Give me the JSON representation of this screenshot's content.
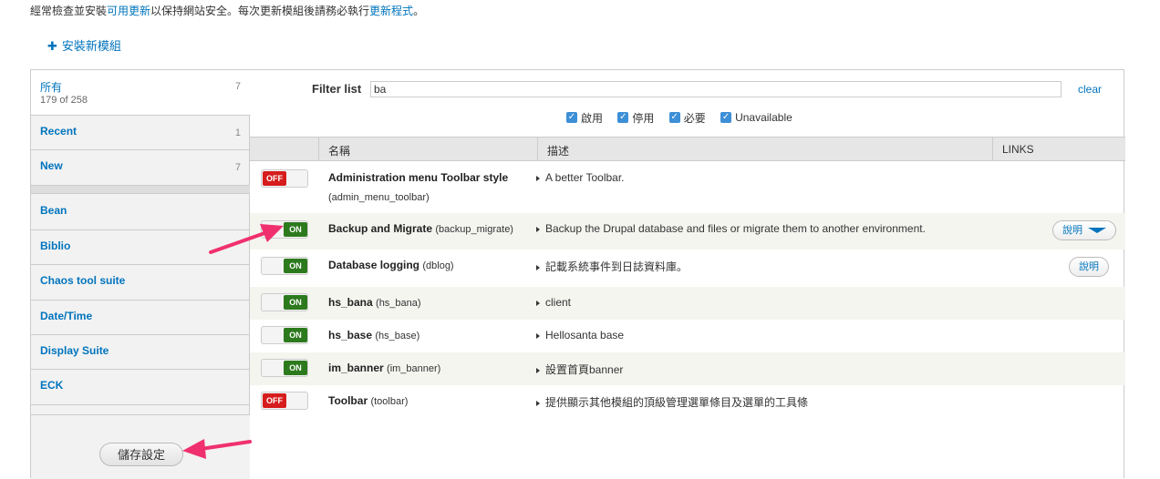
{
  "notice": {
    "pre": "經常檢查並安裝",
    "link1": "可用更新",
    "mid": "以保持網站安全。每次更新模組後請務必執行",
    "link2": "更新程式",
    "post": "。"
  },
  "add_module": {
    "icon": "plus-icon",
    "label": "安裝新模組"
  },
  "sidebar": {
    "all": {
      "label": "所有",
      "sub": "179 of 258",
      "count": "7"
    },
    "items": [
      {
        "label": "Recent",
        "count": "1"
      },
      {
        "label": "New",
        "count": "7"
      },
      {
        "label": "Bean",
        "count": ""
      },
      {
        "label": "Biblio",
        "count": ""
      },
      {
        "label": "Chaos tool suite",
        "count": ""
      },
      {
        "label": "Date/Time",
        "count": ""
      },
      {
        "label": "Display Suite",
        "count": ""
      },
      {
        "label": "ECK",
        "count": ""
      }
    ],
    "save_label": "儲存設定"
  },
  "filter": {
    "label": "Filter list",
    "value": "ba",
    "clear": "clear",
    "checkboxes": [
      "啟用",
      "停用",
      "必要",
      "Unavailable"
    ]
  },
  "table": {
    "headers": {
      "name": "名稱",
      "desc": "描述",
      "links": "LINKS"
    },
    "rows": [
      {
        "status": "OFF",
        "name": "Administration menu Toolbar style",
        "machine": "(admin_menu_toolbar)",
        "desc": "A better Toolbar.",
        "help": ""
      },
      {
        "status": "ON",
        "name": "Backup and Migrate",
        "machine": "(backup_migrate)",
        "desc": "Backup the Drupal database and files or migrate them to another environment.",
        "help": "說明"
      },
      {
        "status": "ON",
        "name": "Database logging",
        "machine": "(dblog)",
        "desc": "記載系統事件到日誌資料庫。",
        "help": "說明"
      },
      {
        "status": "ON",
        "name": "hs_bana",
        "machine": "(hs_bana)",
        "desc": "client",
        "help": ""
      },
      {
        "status": "ON",
        "name": "hs_base",
        "machine": "(hs_base)",
        "desc": "Hellosanta base",
        "help": ""
      },
      {
        "status": "ON",
        "name": "im_banner",
        "machine": "(im_banner)",
        "desc": "設置首頁banner",
        "help": ""
      },
      {
        "status": "OFF",
        "name": "Toolbar",
        "machine": "(toolbar)",
        "desc": "提供顯示其他模組的頂級管理選單條目及選單的工具條",
        "help": ""
      }
    ]
  },
  "colors": {
    "link": "#0074bd",
    "on": "#2c7a1d",
    "off": "#d61c1c",
    "arrow": "#f0306e"
  }
}
